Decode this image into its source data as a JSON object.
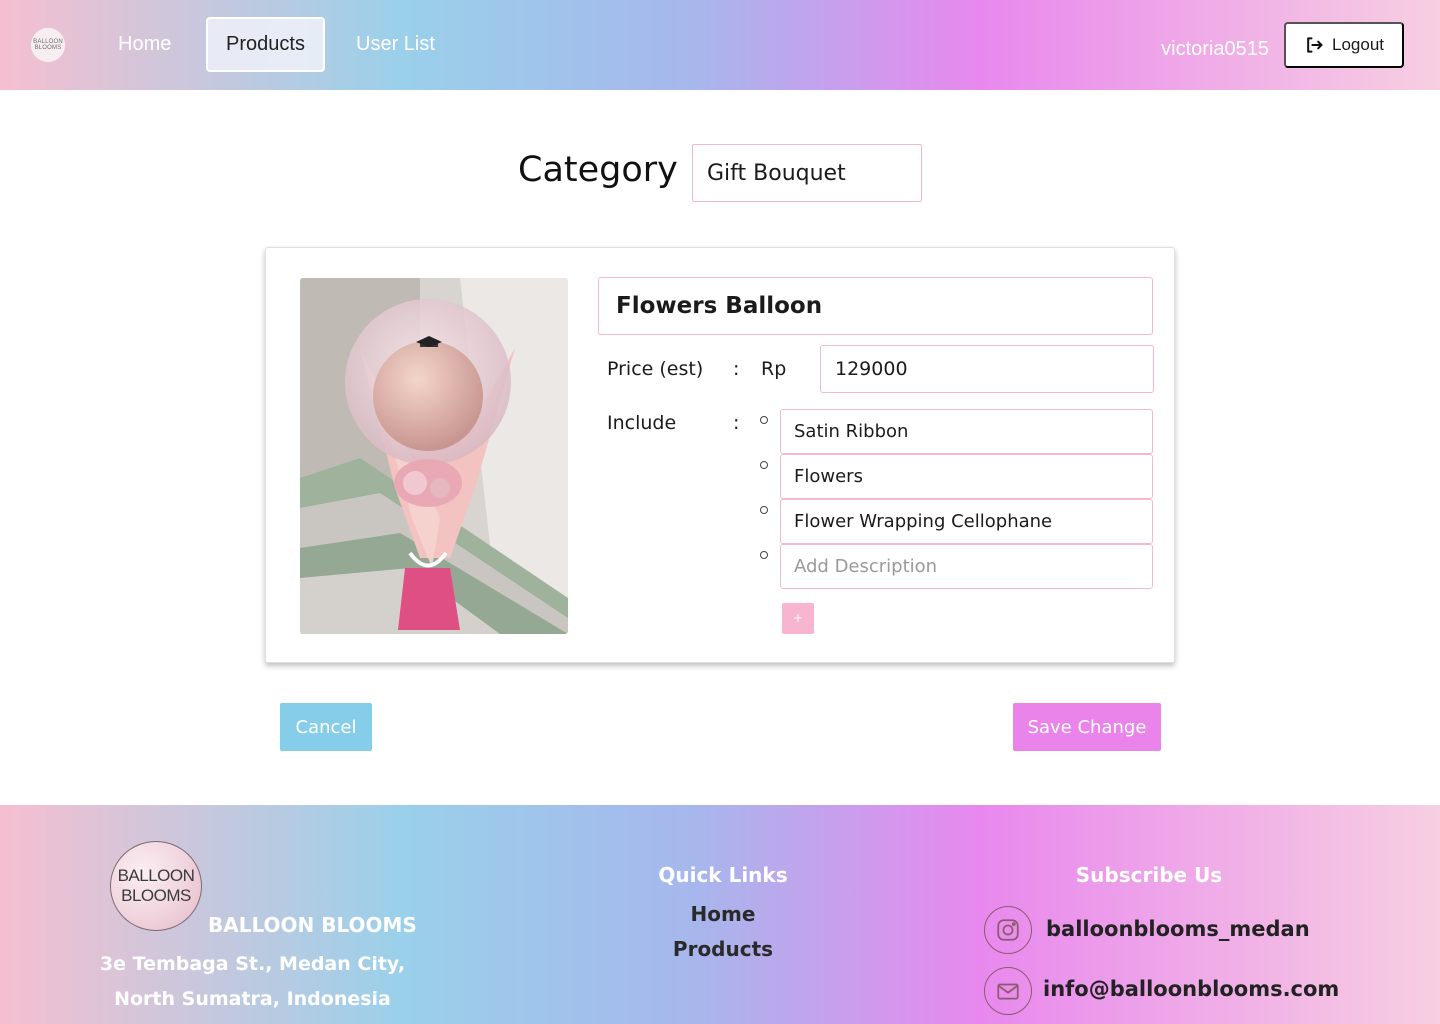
{
  "header": {
    "logo_text": "BALLOON BLOOMS",
    "nav": {
      "home": "Home",
      "products": "Products",
      "user_list": "User List"
    },
    "active_nav": "Products",
    "username": "victoria0515",
    "logout_label": "Logout"
  },
  "category": {
    "label": "Category :",
    "value": "Gift Bouquet"
  },
  "product": {
    "name": "Flowers Balloon",
    "price_label": "Price (est)",
    "colon": ":",
    "currency": "Rp",
    "price": "129000",
    "include_label": "Include",
    "include_items": [
      "Satin Ribbon",
      "Flowers",
      "Flower Wrapping Cellophane"
    ],
    "add_description_placeholder": "Add Description",
    "add_item_label": "+"
  },
  "actions": {
    "cancel": "Cancel",
    "save": "Save Change"
  },
  "footer": {
    "logo_line1": "BALLOON",
    "logo_line2": "BLOOMS",
    "brand": "BALLOON BLOOMS",
    "address": "3e Tembaga St., Medan City, North Sumatra, Indonesia",
    "quick_links_heading": "Quick Links",
    "quick_links": [
      "Home",
      "Products"
    ],
    "subscribe_heading": "Subscribe Us",
    "instagram": "balloonblooms_medan",
    "email": "info@balloonblooms.com"
  },
  "icons": {
    "logout": "logout-icon",
    "instagram": "instagram-icon",
    "email": "mail-icon"
  },
  "colors": {
    "accent_pink": "#ea84ea",
    "accent_blue": "#86cde9",
    "input_border": "#f4b8cf"
  }
}
